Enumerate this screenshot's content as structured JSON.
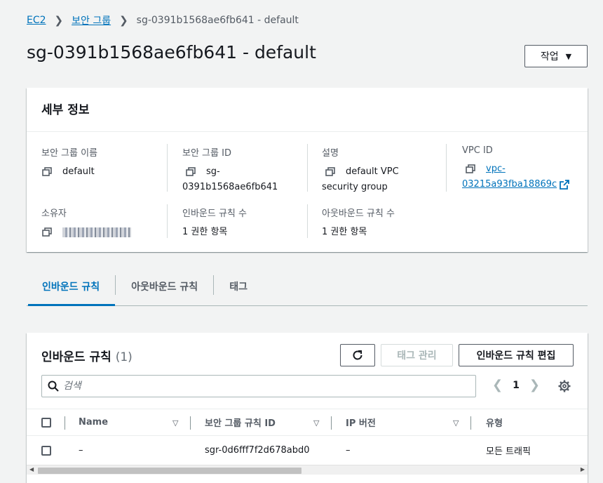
{
  "breadcrumb": {
    "ec2": "EC2",
    "security_groups": "보안 그룹",
    "current": "sg-0391b1568ae6fb641 - default"
  },
  "page": {
    "title": "sg-0391b1568ae6fb641 - default",
    "actions_label": "작업"
  },
  "details": {
    "header": "세부 정보",
    "sg_name_label": "보안 그룹 이름",
    "sg_name": "default",
    "sg_id_label": "보안 그룹 ID",
    "sg_id_line1": "sg-",
    "sg_id_line2": "0391b1568ae6fb641",
    "desc_label": "설명",
    "desc_line1": "default VPC",
    "desc_line2": "security group",
    "vpc_label": "VPC ID",
    "vpc_line1": "vpc-",
    "vpc_line2": "03215a93fba18869c",
    "owner_label": "소유자",
    "inbound_count_label": "인바운드 규칙 수",
    "inbound_count": "1 권한 항목",
    "outbound_count_label": "아웃바운드 규칙 수",
    "outbound_count": "1 권한 항목"
  },
  "tabs": [
    {
      "label": "인바운드 규칙"
    },
    {
      "label": "아웃바운드 규칙"
    },
    {
      "label": "태그"
    }
  ],
  "rules": {
    "title": "인바운드 규칙",
    "count": "(1)",
    "manage_tags": "태그 관리",
    "edit_rules": "인바운드 규칙 편집",
    "search_placeholder": "검색",
    "page": "1",
    "columns": [
      "Name",
      "보안 그룹 규칙 ID",
      "IP 버전",
      "유형"
    ],
    "rows": [
      {
        "name": "–",
        "rule_id": "sgr-0d6fff7f2d678abd0",
        "ip_version": "–",
        "type": "모든 트래픽"
      }
    ]
  },
  "colors": {
    "link": "#0073bb",
    "text": "#16191f",
    "muted": "#545b64",
    "background": "#f2f3f3"
  }
}
